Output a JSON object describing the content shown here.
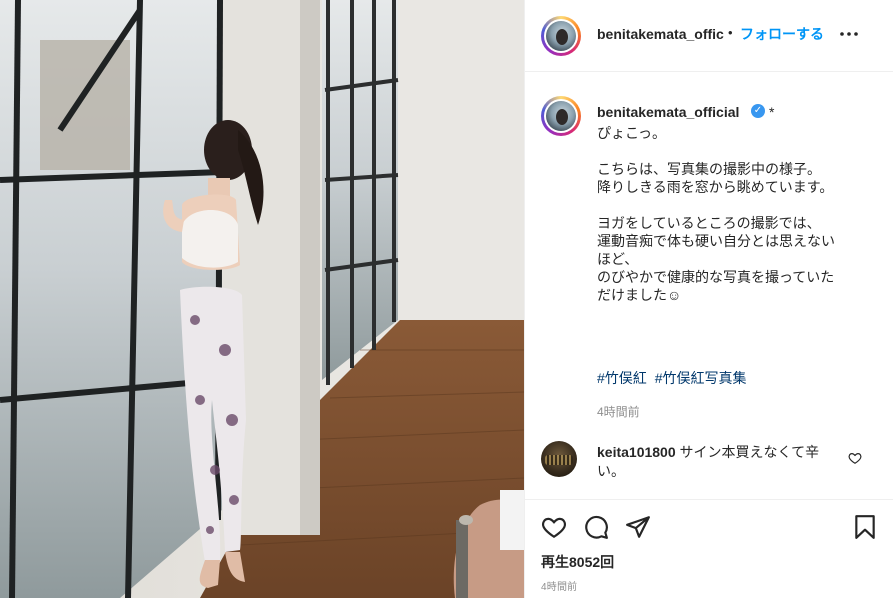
{
  "header": {
    "username": "benitakemata_offic",
    "separator": "•",
    "follow_label": "フォローする",
    "more_label": "•••"
  },
  "caption": {
    "username": "benitakemata_official",
    "verified_mark": "✓",
    "asterisk": "*",
    "text": "ぴょこっ。\n\nこちらは、写真集の撮影中の様子。\n降りしきる雨を窓から眺めています。\n\nヨガをしているところの撮影では、\n運動音痴で体も硬い自分とは思えない\nほど、\nのびやかで健康的な写真を撮っていた\nだけました☺",
    "hashtags": [
      "#竹俣紅",
      "#竹俣紅写真集"
    ],
    "time": "4時間前"
  },
  "comment": {
    "username": "keita101800",
    "text": "サイン本買えなくて辛い。"
  },
  "actions": {
    "views": "再生8052回",
    "time": "4時間前"
  },
  "icons": {
    "like": "heart-icon",
    "comment": "comment-icon",
    "share": "paper-plane-icon",
    "save": "bookmark-icon",
    "more": "ellipsis-icon",
    "verified": "verified-badge-icon"
  },
  "colors": {
    "link_blue": "#0095f6",
    "hashtag": "#00376b",
    "secondary_text": "#8e8e8e",
    "verified": "#3897f0"
  }
}
